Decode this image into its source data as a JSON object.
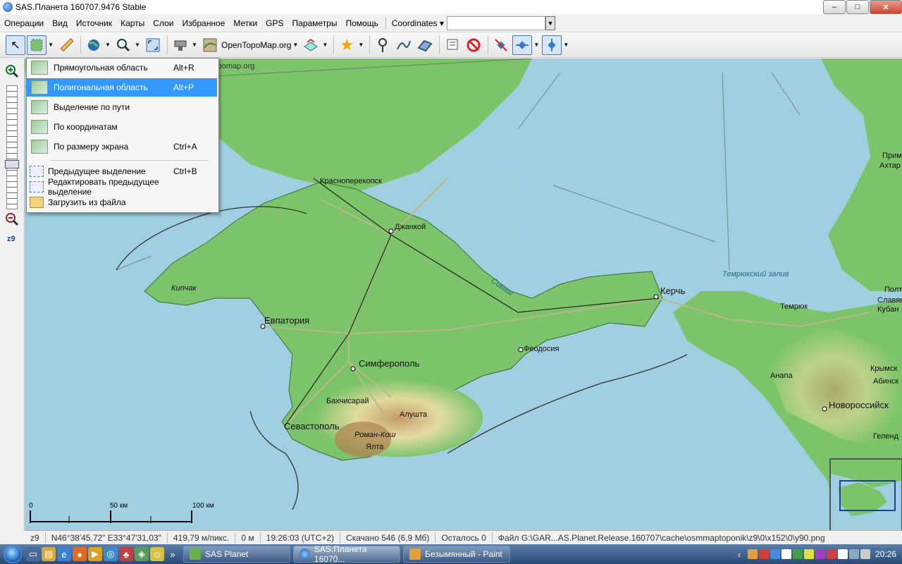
{
  "window": {
    "title": "SAS.Планета 160707.9476 Stable",
    "min": "–",
    "max": "□",
    "close": "✕"
  },
  "menu": {
    "items": [
      "Операции",
      "Вид",
      "Источник",
      "Карты",
      "Слои",
      "Избранное",
      "Метки",
      "GPS",
      "Параметры",
      "Помощь"
    ],
    "coordinates_label": "Coordinates"
  },
  "toolbar": {
    "map_source": "OpenTopoMap.org"
  },
  "selection_menu": {
    "items": [
      {
        "label": "Прямоугольная область",
        "shortcut": "Alt+R"
      },
      {
        "label": "Полигональная область",
        "shortcut": "Alt+P"
      },
      {
        "label": "Выделение по пути",
        "shortcut": ""
      },
      {
        "label": "По координатам",
        "shortcut": ""
      },
      {
        "label": "По размеру экрана",
        "shortcut": "Ctrl+A"
      }
    ],
    "extra": [
      {
        "label": "Предыдущее выделение",
        "shortcut": "Ctrl+B"
      },
      {
        "label": "Редактировать предыдущее выделение",
        "shortcut": ""
      },
      {
        "label": "Загрузить из файла",
        "shortcut": ""
      }
    ]
  },
  "zoom": {
    "level_label": "z9"
  },
  "map": {
    "attribution": "opentopomap.org",
    "labels": {
      "krasnoperekopsk": "Красноперекопск",
      "dzhankoy": "Джанкой",
      "kipchak": "Кипчак",
      "evpatoria": "Евпатория",
      "simferopol": "Симферополь",
      "bakhchisaray": "Бахчисарай",
      "alushta": "Алушта",
      "sevastopol": "Севастополь",
      "roman_kosh": "Роман-Кош",
      "yalta": "Ялта",
      "feodosia": "Феодосия",
      "kerch": "Керчь",
      "sivash": "Сиваш",
      "temryuk_bay": "Темрюкский залив",
      "temryuk": "Темрюк",
      "anapa": "Анапа",
      "krymsk": "Крымск",
      "novorossiysk": "Новороссийск",
      "prim": "Прим",
      "akhtar": "Ахтар",
      "polt": "Полт",
      "slavyan": "Славян",
      "kuban": "Кубан",
      "abinsk": "Абинск",
      "gelend": "Геленд"
    },
    "scale": {
      "zero": "0",
      "mid": "50 км",
      "end": "100 км"
    }
  },
  "status": {
    "zoom": "z9",
    "coords": "N46°38'45,72\" E33°47'31,03\"",
    "resolution": "419,79 м/пикс.",
    "distance": "0 м",
    "time": "19:26:03 (UTC+2)",
    "downloaded": "Скачано 546 (6,9 Мб)",
    "remaining": "Осталось 0",
    "file": "Файл G:\\GAR...AS.Planet.Release.160707\\cache\\osmmaptoponik\\z9\\0\\x152\\0\\y90.png"
  },
  "taskbar": {
    "buttons": [
      {
        "label": "SAS Planet",
        "active": false
      },
      {
        "label": "SAS.Планета 16070...",
        "active": true
      },
      {
        "label": "Безымянный - Paint",
        "active": false
      }
    ],
    "clock": "20:26"
  },
  "colors": {
    "water": "#9fcfe0",
    "land": "#7cc46a",
    "highlight": "#3399ff",
    "taskbar": "#2b4a75"
  }
}
